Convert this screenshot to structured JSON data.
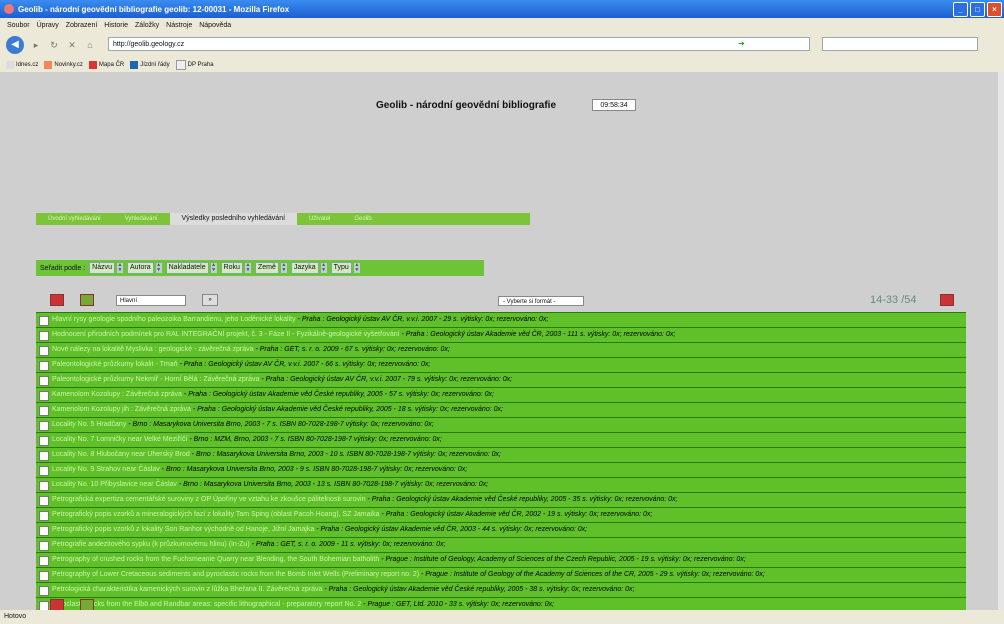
{
  "window": {
    "title": "Geolib - národní geovědní bibliografie geolib: 12-00031 - Mozilla Firefox"
  },
  "menu": [
    "Soubor",
    "Úpravy",
    "Zobrazení",
    "Historie",
    "Záložky",
    "Nástroje",
    "Nápověda"
  ],
  "address": {
    "url": "http://geolib.geology.cz"
  },
  "bookmarks": [
    "Idnes.cz",
    "Novinky.cz",
    "Mapa ČR",
    "Jízdní řády",
    "DP Praha"
  ],
  "page": {
    "title": "Geolib - národní geovědní bibliografie",
    "clock": "09:58:34",
    "tabs": [
      "Úvodní vyhledávání",
      "Vyhledávání",
      "Výsledky posledního vyhledávání",
      "Uživatel",
      "Geolib"
    ],
    "sort": {
      "label": "Seřadit podle :",
      "fields": [
        "Názvu",
        "Autora",
        "Nakladatele",
        "Roku",
        "Země",
        "Jazyka",
        "Typu"
      ]
    },
    "hint_input": "Hlavní",
    "format_select": "- Vyberte si formát -",
    "pager": "14-33 /54",
    "results": [
      {
        "title": "Hlavní rysy geologie spodního paleozoika Barrandienu, jeho Loděnické lokality",
        "rest": " - Praha : Geologický ústav AV ČR, v.v.i. 2007 - 29 s. výtisky: 0x; rezervováno: 0x;"
      },
      {
        "title": "Hodnocení přírodních podmínek pro RAL INTEGRAČNÍ projekt, č. 3 - Fáze II - Fyzikálně-geologické vyšetřování",
        "rest": " - Praha : Geologický ústav Akademie věd ČR, 2003 - 111 s. výtisky: 0x; rezervováno: 0x;"
      },
      {
        "title": "Nové nálezy na lokalitě Myslivka : geologické - závěrečná zpráva",
        "rest": " - Praha : GET, s. r. o. 2009 - 67 s. výtisky: 0x; rezervováno: 0x;"
      },
      {
        "title": "Paleontologické průzkumy lokalit - Tmaň",
        "rest": " - Praha : Geologický ústav AV ČR, v.v.i. 2007 - 66 s. výtisky: 0x; rezervováno: 0x;"
      },
      {
        "title": "Paleontologické průzkumy Nekmíř - Horní Bělá : Závěrečná zpráva",
        "rest": " - Praha : Geologický ústav AV ČR, v.v.i. 2007 - 79 s. výtisky: 0x; rezervováno: 0x;"
      },
      {
        "title": "Kamenolom Kozolupy : Závěrečná zpráva",
        "rest": " - Praha : Geologický ústav Akademie věd České republiky, 2005 - 57 s. výtisky: 0x; rezervováno: 0x;"
      },
      {
        "title": "Kamenolom Kozolupy jih : Závěrečná zpráva",
        "rest": " - Praha : Geologický ústav Akademie věd České republiky, 2005 - 18 s. výtisky: 0x; rezervováno: 0x;"
      },
      {
        "title": "Locality No. 5 Hradčany",
        "rest": " - Brno : Masarykova Universita Brno, 2003 - 7 s. ISBN 80-7028-198-7 výtisky: 0x; rezervováno: 0x;"
      },
      {
        "title": "Locality No. 7 Lomničky near Velké Meziříčí",
        "rest": " - Brno : MZM, Brno, 2003 - 7 s. ISBN 80-7028-198-7 výtisky: 0x; rezervováno: 0x;"
      },
      {
        "title": "Locality No. 8 Hlubočany near Uherský Brod",
        "rest": " - Brno : Masarykova Universita Brno, 2003 - 10 s. ISBN 80-7028-198-7 výtisky: 0x; rezervováno: 0x;"
      },
      {
        "title": "Locality No. 9 Strahov near Čáslav",
        "rest": " - Brno : Masarykova Universita Brno, 2003 - 9 s. ISBN 80-7028-198-7 výtisky: 0x; rezervováno: 0x;"
      },
      {
        "title": "Locality No. 10 Přibyslavice near Čáslav",
        "rest": " - Brno : Masarykova Universita Brno, 2003 - 13 s. ISBN 80-7028-198-7 výtisky: 0x; rezervováno: 0x;"
      },
      {
        "title": "Petrografická expertiza cementářské suroviny z OP Úpořiny ve vztahu ke zkoušce pálitelnosti surovin",
        "rest": " - Praha : Geologický ústav Akademie věd České republiky, 2005 - 35 s. výtisky: 0x; rezervováno: 0x;"
      },
      {
        "title": "Petrografický popis vzorků a mineralogických fazí z lokality Tam Sping (oblast Pacoh Hoang), SZ Jamaika",
        "rest": " - Praha : Geologický ústav Akademie věd ČR, 2002 - 19 s. výtisky: 0x; rezervováno: 0x;"
      },
      {
        "title": "Petrografický popis vzorků z lokality Son Ranhor východně od Hanoje, Jižní Jamajka",
        "rest": " - Praha : Geologický ústav Akademie věd ČR, 2003 - 44 s. výtisky: 0x; rezervováno: 0x;"
      },
      {
        "title": "Petrografie andezitového sypku (k průzkumovému hlinu) (In-Zu)",
        "rest": " - Praha : GET, s. r. o. 2009 - 11 s. výtisky: 0x; rezervováno: 0x;"
      },
      {
        "title": "Petrography of crushed rocks from the Fuchsmeanie Quarry near Blending, the South Bohemian batholith",
        "rest": " - Prague : Institute of Geology, Academy of Sciences of the Czech Republic, 2005 - 19 s. výtisky: 0x; rezervováno: 0x;"
      },
      {
        "title": "Petrography of Lower Cretaceous sediments and pyroclastic rocks from the Bomb Inlet Wells (Preliminary report no. 2)",
        "rest": " - Prague : Institute of Geology of the Academy of Sciences of the CR, 2005 - 29 s. výtisky: 0x; rezervováno: 0x;"
      },
      {
        "title": "Petrologická charakteristika kamenických surovin z lůžka Bheřana II. Závěrečná zpráva",
        "rest": " - Praha : Geologický ústav Akademie věd České republiky, 2005 - 38 s. výtisky: 0x; rezervováno: 0x;"
      },
      {
        "title": "Pyroclastic rocks from the Elbö and Randbar areas: specific lithographical - preparatory report No. 2",
        "rest": " - Prague : GET, Ltd. 2010 - 33 s. výtisky: 0x; rezervováno: 0x;"
      }
    ]
  },
  "status": "Hotovo"
}
